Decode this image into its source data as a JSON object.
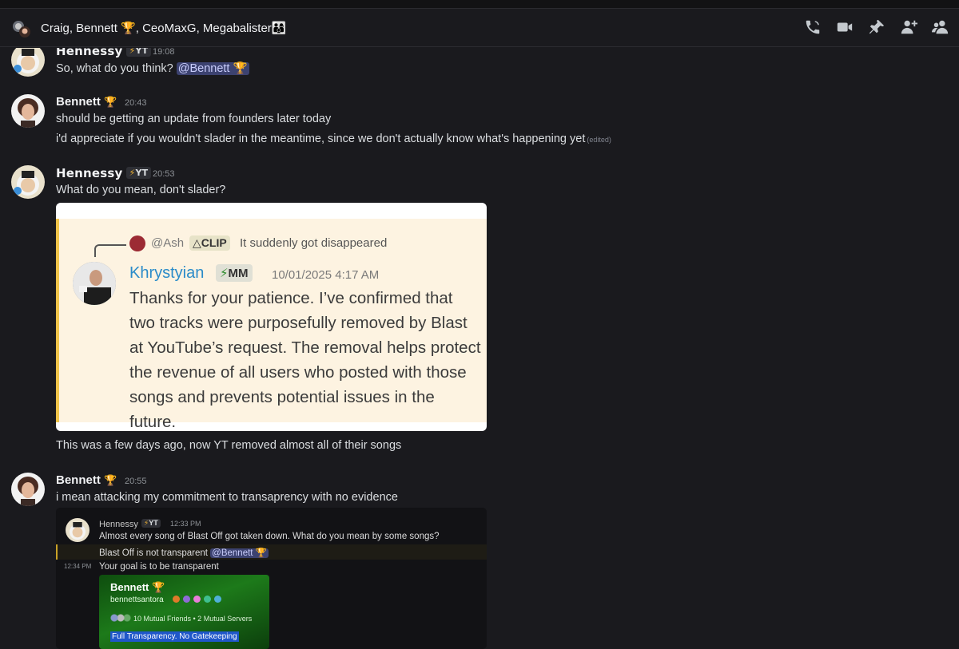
{
  "header": {
    "title": "Craig, Bennett 🏆, CeoMaxG, Megabalister👨‍👩‍👦",
    "icons": [
      "group-avatar-icon",
      "call-icon",
      "video-icon",
      "pin-icon",
      "add-member-icon",
      "members-icon"
    ]
  },
  "messages": [
    {
      "author": "Hennessy",
      "tag": "YT",
      "time": "19:08",
      "lines": [
        "So, what do you think?"
      ],
      "mention": "@Bennett 🏆"
    },
    {
      "author": "Bennett",
      "badge": "🏆",
      "time": "20:43",
      "lines": [
        "should be getting an update from founders later today",
        "i'd appreciate if you wouldn't slader in the meantime, since we don't actually know what's happening yet"
      ],
      "edited": "(edited)"
    },
    {
      "author": "Hennessy",
      "tag": "YT",
      "time": "20:53",
      "lines": [
        "What do you mean, don't slader?"
      ],
      "after_image": "This was a few days ago, now YT removed almost all of their songs"
    },
    {
      "author": "Bennett",
      "badge": "🏆",
      "time": "20:55",
      "lines": [
        "i mean attacking my commitment to transaprency with no evidence"
      ]
    }
  ],
  "quote1": {
    "reply_name": "@Ash",
    "reply_tag": "CLIP",
    "reply_text": "It suddenly got disappeared",
    "author": "Khrystyian",
    "author_tag": "MM",
    "time": "10/01/2025 4:17 AM",
    "body": "Thanks for your patience. I’ve confirmed that two tracks were purposefully removed by Blast at YouTube’s request. The removal helps protect the revenue of all users who posted with those songs and prevents potential issues in the future."
  },
  "quote2": {
    "author": "Hennessy",
    "tag": "YT",
    "time": "12:33 PM",
    "line1": "Almost every song of Blast Off got taken down. What do you mean by some songs?",
    "line2": "Blast Off is not transparent",
    "mention": "@Bennett 🏆",
    "time2": "12:34 PM",
    "line3": "Your goal is to be transparent",
    "card": {
      "name": "Bennett 🏆",
      "username": "bennettsantora",
      "mutual": "10 Mutual Friends • 2 Mutual Servers",
      "bio": "Full Transparency. No Gatekeeping"
    }
  },
  "colors": {
    "background": "#1a1a1e",
    "mention_bg": "#3c4270",
    "link_blue": "#2a8bc9",
    "quote_accent": "#f0c44a"
  }
}
